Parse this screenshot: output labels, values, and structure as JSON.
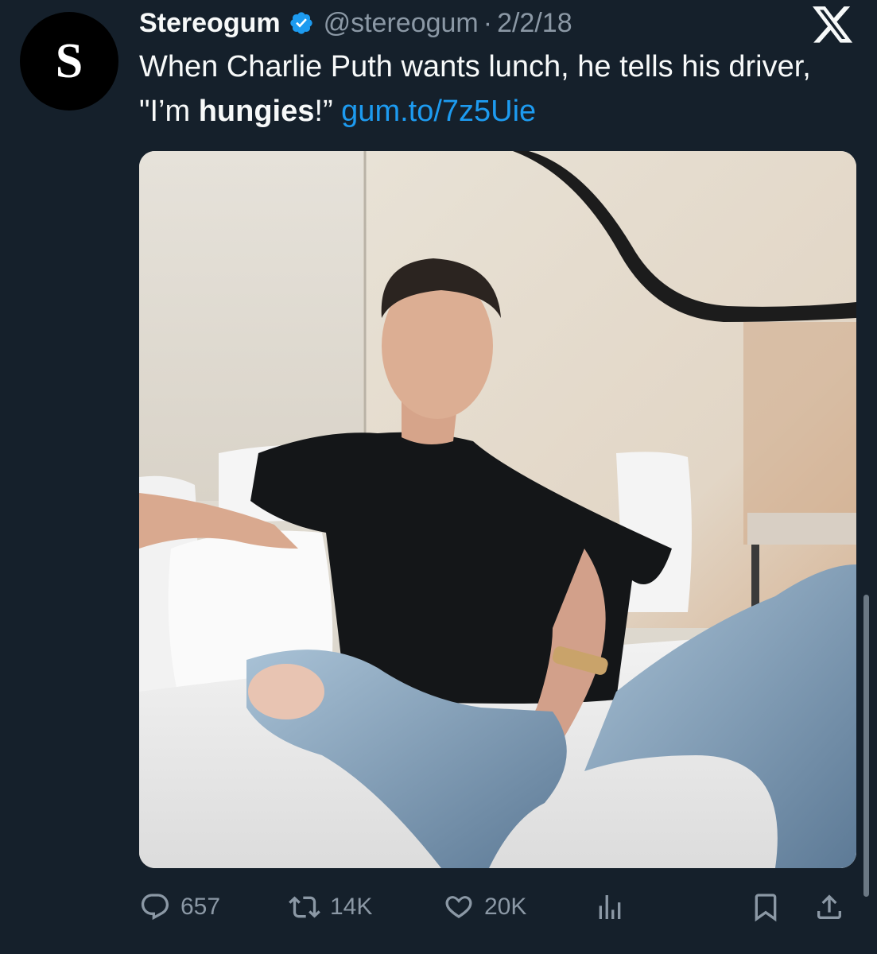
{
  "author": {
    "avatar_letter": "S",
    "display_name": "Stereogum",
    "handle": "@stereogum",
    "separator": "·",
    "date": "2/2/18",
    "verified": true
  },
  "tweet": {
    "text_part1": "When Charlie Puth wants lunch, he tells his driver, \"I’m ",
    "text_bold": "hungies",
    "text_part2": "!” ",
    "link": "gum.to/7z5Uie"
  },
  "actions": {
    "replies": "657",
    "retweets": "14K",
    "likes": "20K"
  },
  "icons": {
    "close": "x-logo-icon",
    "reply": "reply-icon",
    "retweet": "retweet-icon",
    "like": "heart-icon",
    "views": "views-icon",
    "bookmark": "bookmark-icon",
    "share": "share-icon",
    "verified": "verified-badge-icon"
  },
  "colors": {
    "background": "#15202b",
    "text": "#f7f9f9",
    "muted": "#8b98a5",
    "link": "#1d9bf0",
    "verified": "#1d9bf0"
  }
}
